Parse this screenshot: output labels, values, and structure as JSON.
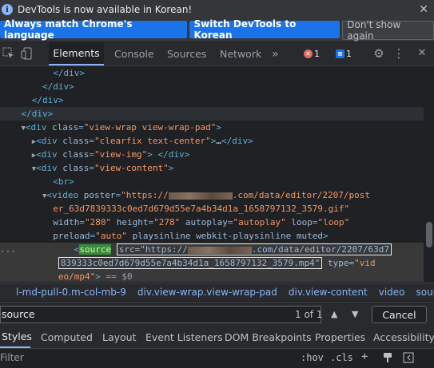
{
  "infobar": {
    "message": "DevTools is now available in Korean!",
    "buttons": {
      "match": "Always match Chrome's language",
      "switch": "Switch DevTools to Korean",
      "dismiss": "Don't show again"
    },
    "close_glyph": "✕"
  },
  "toolbar": {
    "tabs": [
      "Elements",
      "Console",
      "Sources",
      "Network"
    ],
    "more": "»",
    "error_count": "1",
    "message_count": "1"
  },
  "code": {
    "lines": [
      {
        "indent": "          ",
        "text": "</div>"
      },
      {
        "indent": "        ",
        "text": "</div>"
      },
      {
        "indent": "      ",
        "text": "</div>"
      },
      {
        "indent": "    ",
        "text": "</div>"
      }
    ],
    "wrap_div": {
      "class": "view-wrap view-wrap-pad"
    },
    "clearfix_div": {
      "class": "clearfix text-center",
      "ellipsis": "…"
    },
    "img_div": {
      "class": "view-img"
    },
    "content_div": {
      "class": "view-content"
    },
    "br": "<br>",
    "video": {
      "poster_start": "https://",
      "poster_rest": ".com/data/editor/2207/post",
      "poster_line2": "er_63d7839333c0ed7d679d55e7a4b34d1a_1658797132_3579.gif\"",
      "width": "280",
      "height": "278",
      "autoplay": "autoplay",
      "loop": "loop",
      "preload": "auto",
      "flags": "playsinline webkit-playsinline muted"
    },
    "source": {
      "tag_highlight": "source",
      "src_start": "src=\"https://",
      "src_rest": ".com/data/editor/2207/63d7",
      "src_line2": "839333c0ed7d679d55e7a4b34d1a_1658797132_3579.mp4\"",
      "type_attr": "type=",
      "type_val_a": "\"vid",
      "type_val_b": "eo/mp4\"",
      "suffix": " == $0",
      "gutter": "..."
    }
  },
  "breadcrumbs": [
    "l-md-pull-0.m-col-mb-9",
    "div.view-wrap.view-wrap-pad",
    "div.view-content",
    "video",
    "source"
  ],
  "search": {
    "value": "source",
    "count": "1 of 1",
    "cancel": "Cancel"
  },
  "subtabs": [
    "Styles",
    "Computed",
    "Layout",
    "Event Listeners",
    "DOM Breakpoints",
    "Properties",
    "Accessibility"
  ],
  "filter": {
    "placeholder": "Filter",
    "hov": ":hov",
    "cls": ".cls",
    "plus": "+"
  },
  "colors": {
    "accent": "#8ab4f8",
    "primary_button": "#1a73e8",
    "tag": "#5db0d7",
    "attr_value": "#f29766",
    "search_highlight": "#3a8b3a"
  }
}
